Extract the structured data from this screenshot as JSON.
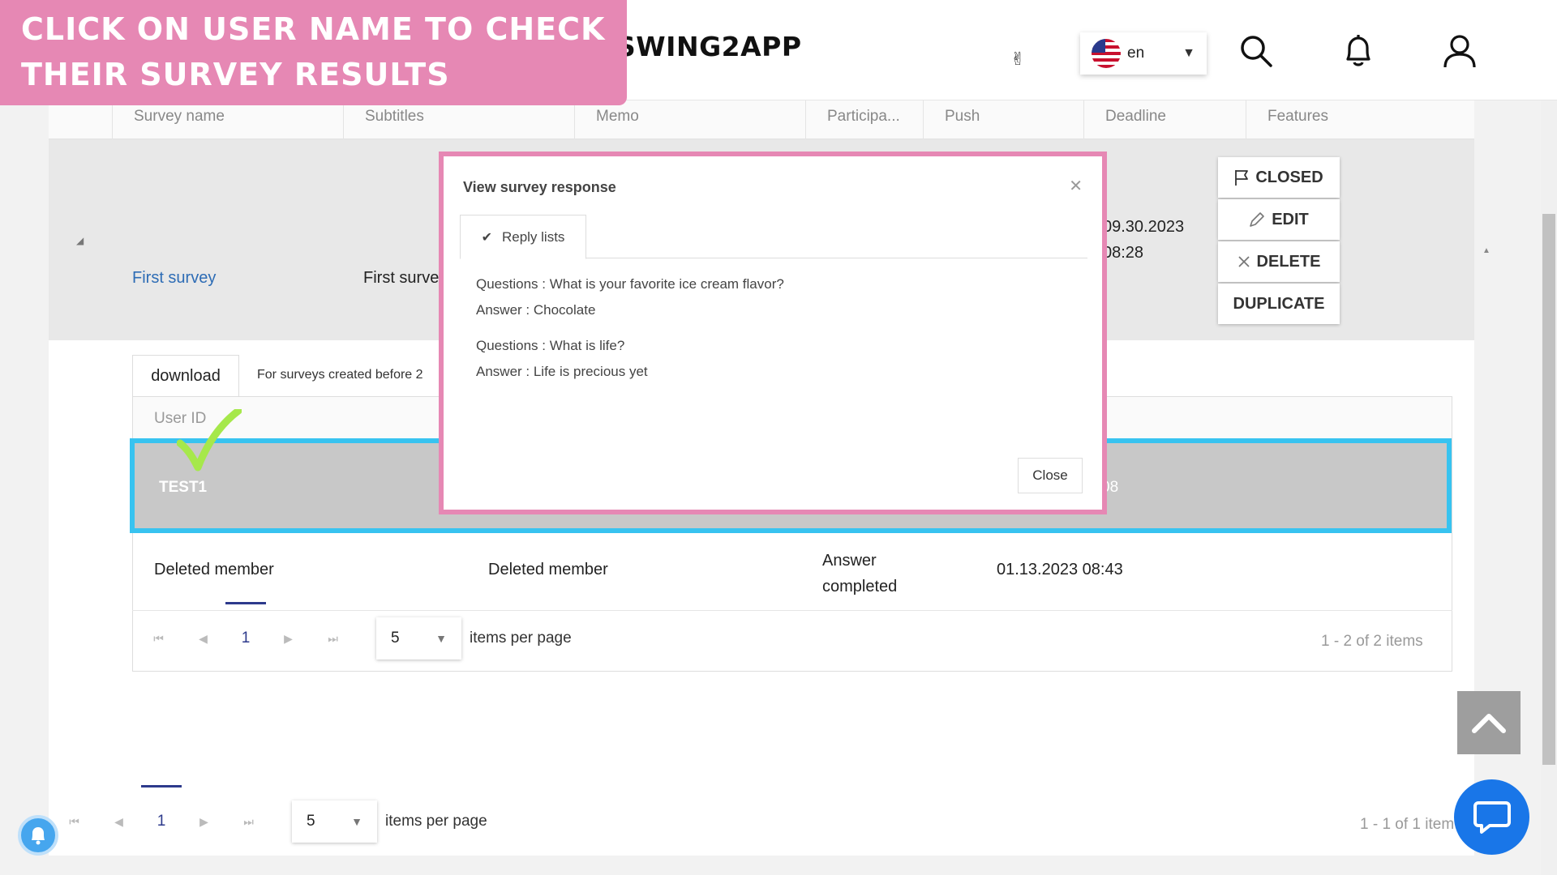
{
  "banner": {
    "text": "Click on user name to check their survey results"
  },
  "header": {
    "logo": "SWING2APP",
    "language": {
      "code": "en"
    },
    "icons": [
      "peace-icon",
      "search-icon",
      "bell-icon",
      "user-icon"
    ]
  },
  "grid": {
    "columns": [
      "Survey name",
      "Subtitles",
      "Memo",
      "Participa...",
      "Push",
      "Deadline",
      "Features"
    ],
    "row": {
      "survey_name": "First survey",
      "subtitle": "First surve",
      "deadline_date": "09.30.2023",
      "deadline_time": "08:28"
    },
    "features": {
      "closed": "CLOSED",
      "edit": "EDIT",
      "delete": "DELETE",
      "duplicate": "DUPLICATE"
    }
  },
  "detail": {
    "download_label": "download",
    "download_note": "For surveys created before 2",
    "columns": {
      "user_id": "User ID"
    },
    "rows": [
      {
        "user_id": "TEST1",
        "tail": "08"
      },
      {
        "user_id": "Deleted member",
        "name": "Deleted member",
        "status_line1": "Answer",
        "status_line2": "completed",
        "date": "01.13.2023 08:43"
      }
    ],
    "pager": {
      "page": "1",
      "per_page": "5",
      "per_page_label": "items per page",
      "info": "1 - 2 of 2 items"
    }
  },
  "outer_pager": {
    "page": "1",
    "per_page": "5",
    "per_page_label": "items per page",
    "info": "1 - 1 of 1 item"
  },
  "modal": {
    "title": "View survey response",
    "tab": "Reply lists",
    "qa": [
      {
        "question": "Questions : What is your favorite ice cream flavor?",
        "answer": "Answer : Chocolate"
      },
      {
        "question": "Questions : What is life?",
        "answer": "Answer : Life is precious yet"
      }
    ],
    "close_label": "Close"
  },
  "colors": {
    "banner": "#e688b4",
    "highlight": "#38c3f0",
    "link": "#2d6cb5",
    "check": "#a6e84b"
  }
}
